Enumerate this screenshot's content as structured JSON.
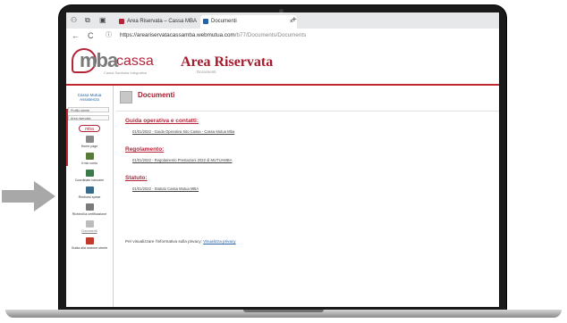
{
  "browser": {
    "tabs": [
      {
        "label": "Area Riservata – Cassa MBA",
        "active": false,
        "favicon_color": "#b5253a"
      },
      {
        "label": "Documenti",
        "active": true,
        "favicon_color": "#2563a8"
      }
    ],
    "tab_close_glyph": "×",
    "new_tab_glyph": "+",
    "nav": {
      "back": "←",
      "reload": "C",
      "info": "ⓘ"
    },
    "url": {
      "host": "https://areariservatacassamba.webmutua.com",
      "path": "/b77/Documents/Documents"
    },
    "icons": [
      "workspaces-icon",
      "tab-groups-icon",
      "tab-actions-icon"
    ]
  },
  "header": {
    "logo_mba": "mba",
    "logo_cassa": "cassa",
    "logo_tagline": "Cassa Sanitaria Integrativa",
    "title": "Area Riservata",
    "subtitle": "Documenti",
    "accent_color": "#b5253a"
  },
  "sidebar": {
    "brand": "Cassa Mutua Assistenza",
    "profile_field": "Profilo utente",
    "menu_field": "Area riservata",
    "mini_logo": "mba",
    "items": [
      {
        "label": "Home page",
        "icon": "home-icon"
      },
      {
        "label": "Il mio conto",
        "icon": "account-icon"
      },
      {
        "label": "Coordinate bancarie",
        "icon": "bank-icon"
      },
      {
        "label": "Rimborsi spese",
        "icon": "refund-icon"
      },
      {
        "label": "Richiedi la certificazione",
        "icon": "certificate-icon"
      },
      {
        "label": "Documenti",
        "icon": "documents-icon",
        "selected": true
      },
      {
        "label": "Guida alla sezione utente",
        "icon": "guide-icon"
      }
    ]
  },
  "content": {
    "title": "Documenti",
    "sections": [
      {
        "heading": "Guida operativa e contatti:",
        "link": "01/01/2022 - Guida Operativa Sito Cassa - Cassa Mutua Mba"
      },
      {
        "heading": "Regolamento:",
        "link": "01/01/2022 - Regolamento Prestazioni 2022 di MUTUAMBA"
      },
      {
        "heading": "Statuto:",
        "link": "01/01/2022 - Statuto Cassa Mutua MBA"
      }
    ],
    "privacy_text": "Per visualizzare l'informativa sulla privacy: ",
    "privacy_link": "Visualizza privacy"
  }
}
